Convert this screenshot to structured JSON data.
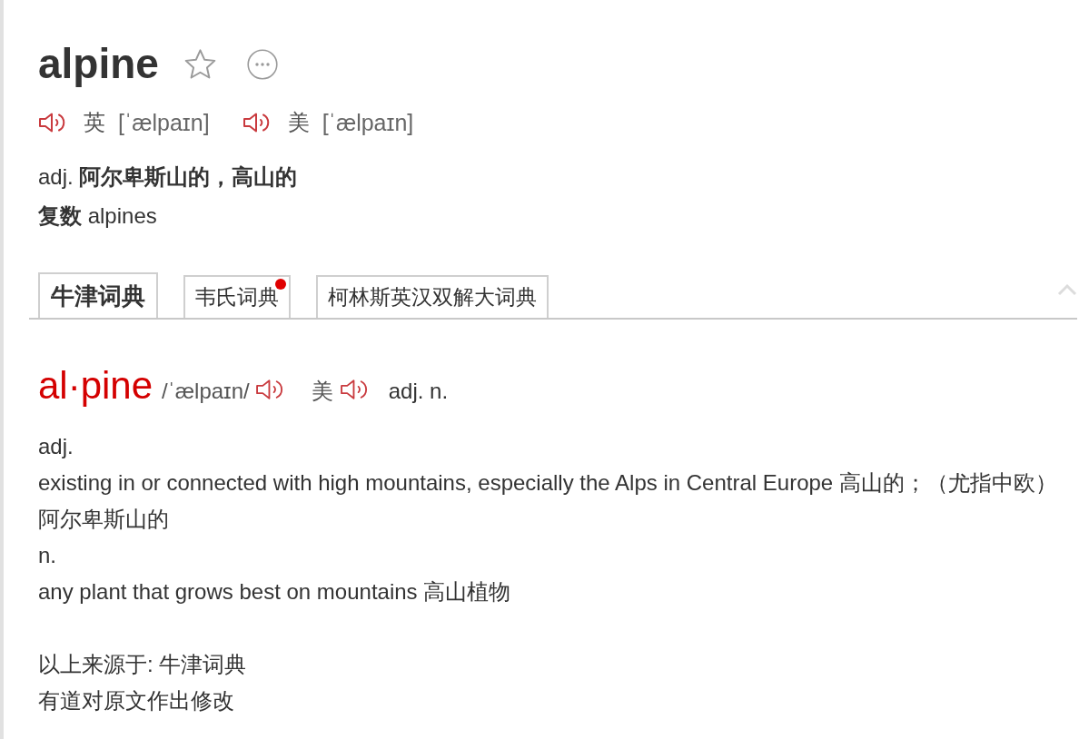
{
  "headword": "alpine",
  "pronunciations": [
    {
      "region": "英",
      "phonetic": "[ˈælpaɪn]"
    },
    {
      "region": "美",
      "phonetic": "[ˈælpaɪn]"
    }
  ],
  "definition": "adj. **阿尔卑斯山的，高山的**",
  "plural": "**复数** alpines",
  "tabs": [
    {
      "label": "牛津词典",
      "selected": true,
      "dot": false
    },
    {
      "label": "韦氏词典",
      "selected": false,
      "dot": true
    },
    {
      "label": "柯林斯英汉双解大词典",
      "selected": false,
      "dot": false
    }
  ],
  "entry": {
    "headword": "al·pine",
    "phonetic": "/ˈælpaɪn/",
    "region": "美",
    "parts_of_speech": "adj. n.",
    "senses": [
      {
        "pos": "adj.",
        "definition": "existing in or connected with high mountains, especially the Alps in Central Europe 高山的；（尤指中欧）阿尔卑斯山的"
      },
      {
        "pos": "n.",
        "definition": "any plant that grows best on mountains 高山植物"
      }
    ],
    "source": [
      "以上来源于: 牛津词典",
      "有道对原文作出修改"
    ]
  }
}
